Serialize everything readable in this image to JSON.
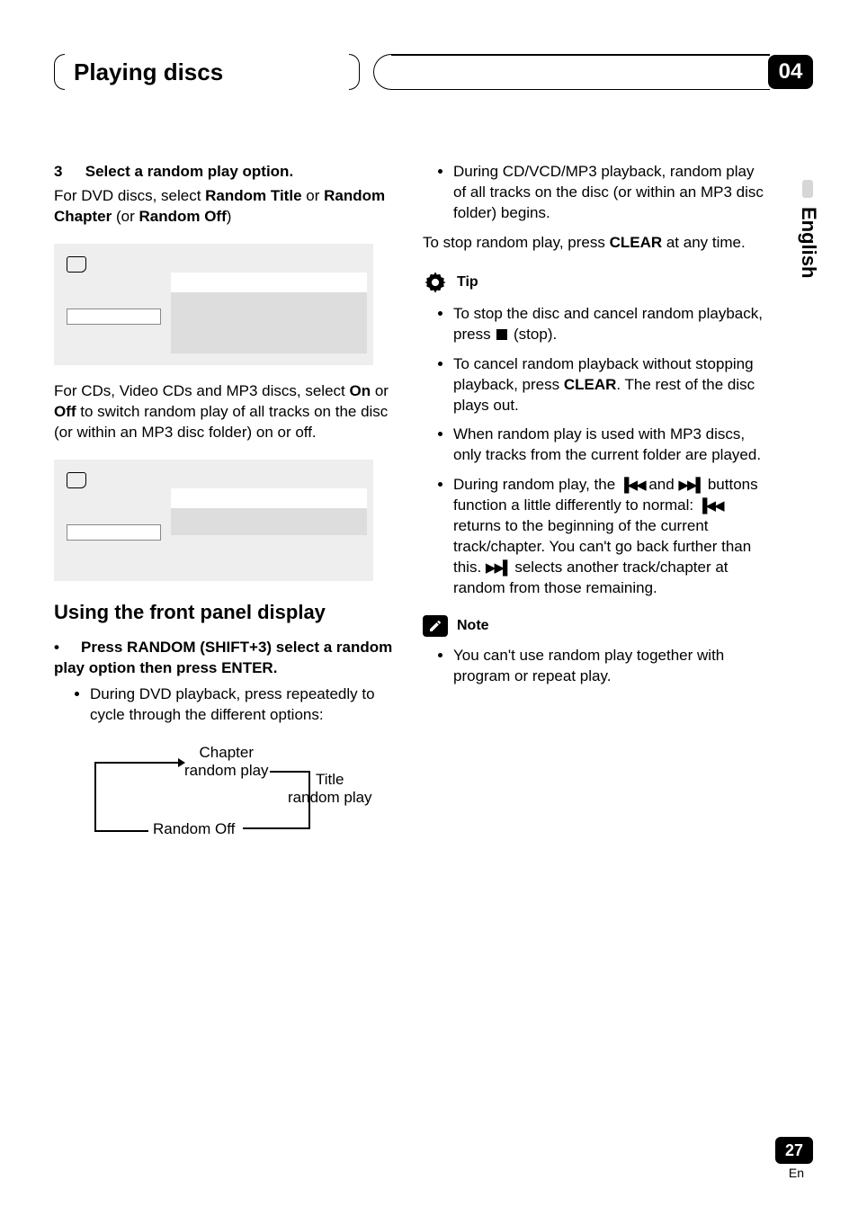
{
  "header": {
    "chapter_title": "Playing discs",
    "chapter_number": "04"
  },
  "side": {
    "language": "English"
  },
  "left_col": {
    "step3_num": "3",
    "step3_title": "Select a random play option.",
    "step3_body_pre": "For DVD discs, select ",
    "step3_b1": "Random Title",
    "step3_mid": " or ",
    "step3_b2": "Random Chapter",
    "step3_mid2": " (or ",
    "step3_b3": "Random Off",
    "step3_end": ")",
    "para2_pre": "For CDs, Video CDs and MP3 discs, select ",
    "para2_b1": "On",
    "para2_mid": " or ",
    "para2_b2": "Off",
    "para2_end": " to switch random play of all tracks on the disc (or within an MP3 disc folder) on or off.",
    "subheading": "Using the front panel display",
    "substep_bullet": "•",
    "substep_text": "Press RANDOM (SHIFT+3) select a random play option then press ENTER.",
    "sub_li1": "During DVD playback, press repeatedly to cycle through the different options:",
    "cycle": {
      "chapter": "Chapter\nrandom play",
      "title": "Title\nrandom play",
      "off": "Random Off"
    }
  },
  "right_col": {
    "top_li": "During CD/VCD/MP3 playback, random play of all tracks on the disc (or within an MP3 disc folder) begins.",
    "stop_line_pre": "To stop random play, press ",
    "stop_bold": "CLEAR",
    "stop_line_post": " at any time.",
    "tip_label": "Tip",
    "tip1_pre": "To stop the disc and cancel random playback, press ",
    "tip1_post": " (stop).",
    "tip2_pre": "To cancel random playback without stopping playback, press ",
    "tip2_b": "CLEAR",
    "tip2_post": ". The rest of the disc plays out.",
    "tip3": "When random play is used with MP3 discs, only tracks from the current folder are played.",
    "tip4_pre": "During random play, the ",
    "tip4_mid1": " and ",
    "tip4_mid2": " buttons function a little differently to normal: ",
    "tip4_mid3": " returns to the beginning of the current track/chapter. You can't go back further than this. ",
    "tip4_post": " selects another track/chapter at random from those remaining.",
    "note_label": "Note",
    "note1": "You can't use random play together with program or repeat play."
  },
  "footer": {
    "page": "27",
    "lang": "En"
  }
}
